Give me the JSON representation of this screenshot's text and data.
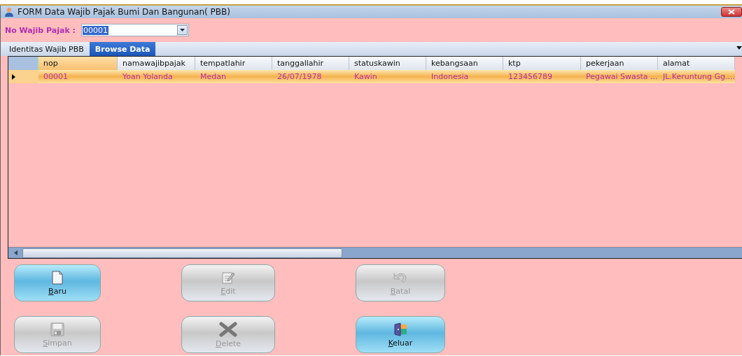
{
  "window": {
    "title": "FORM Data Wajib Pajak Bumi Dan Bangunan( PBB)"
  },
  "no_wajib_pajak": {
    "label": "No Wajib Pajak :",
    "value": "00001"
  },
  "tabs": [
    {
      "label": "Identitas Wajib PBB",
      "selected": false
    },
    {
      "label": "Browse Data",
      "selected": true
    }
  ],
  "table": {
    "columns": [
      "nop",
      "namawajibpajak",
      "tempatlahir",
      "tanggallahir",
      "statuskawin",
      "kebangsaan",
      "ktp",
      "pekerjaan",
      "alamat"
    ],
    "rows": [
      {
        "selected": true,
        "cells": [
          "00001",
          "Yoan Yolanda",
          "Medan",
          "26/07/1978",
          "Kawin",
          "Indonesia",
          "123456789",
          "Pegawai Swasta ...",
          "JL.Keruntung Gg...."
        ]
      }
    ]
  },
  "buttons": [
    {
      "label": "Baru",
      "kind": "new",
      "disabled": false
    },
    {
      "label": "Edit",
      "kind": "edit",
      "disabled": true
    },
    {
      "label": "Batal",
      "kind": "undo",
      "disabled": true
    },
    {
      "label": "Simpan",
      "kind": "save",
      "disabled": true
    },
    {
      "label": "Delete",
      "kind": "delete",
      "disabled": true
    },
    {
      "label": "Keluar",
      "kind": "exit",
      "disabled": false
    }
  ]
}
